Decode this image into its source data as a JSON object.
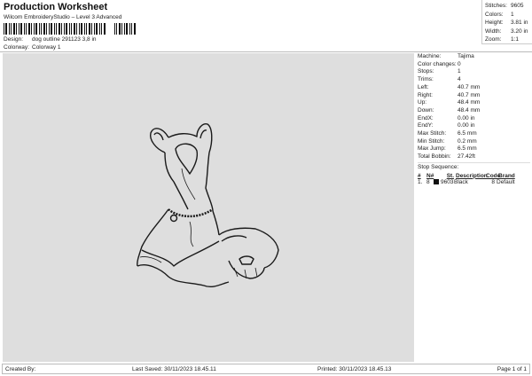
{
  "header": {
    "title": "Production Worksheet",
    "subtitle": "Wilcom EmbroideryStudio – Level 3 Advanced",
    "design_label": "Design:",
    "design_value": "dog outline 291123 3,8 in",
    "colorway_label": "Colorway:",
    "colorway_value": "Colorway 1"
  },
  "summary": [
    {
      "label": "Stitches:",
      "value": "9605"
    },
    {
      "label": "Colors:",
      "value": "1"
    },
    {
      "label": "Height:",
      "value": "3.81 in"
    },
    {
      "label": "Width:",
      "value": "3.20 in"
    },
    {
      "label": "Zoom:",
      "value": "1:1"
    }
  ],
  "details": [
    {
      "label": "Machine:",
      "value": "Tajima"
    },
    {
      "label": "Color changes:",
      "value": "0"
    },
    {
      "label": "Stops:",
      "value": "1"
    },
    {
      "label": "Trims:",
      "value": "4"
    },
    {
      "label": "Left:",
      "value": "40.7 mm"
    },
    {
      "label": "Right:",
      "value": "40.7 mm"
    },
    {
      "label": "Up:",
      "value": "48.4 mm"
    },
    {
      "label": "Down:",
      "value": "48.4 mm"
    },
    {
      "label": "EndX:",
      "value": "0.00 in"
    },
    {
      "label": "EndY:",
      "value": "0.00 in"
    },
    {
      "label": "Max Stitch:",
      "value": "6.5 mm"
    },
    {
      "label": "Min Stitch:",
      "value": "0.2 mm"
    },
    {
      "label": "Max Jump:",
      "value": "6.5 mm"
    },
    {
      "label": "Total Bobbin:",
      "value": "27.42ft"
    }
  ],
  "stop_sequence": {
    "title": "Stop Sequence:",
    "headers": [
      "#",
      "N#",
      "St.",
      "Description",
      "Code",
      "Brand"
    ],
    "rows": [
      {
        "num": "1.",
        "n": "8",
        "color": "#111111",
        "st": "9603",
        "desc": "Black",
        "code": "8",
        "brand": "Default"
      }
    ]
  },
  "footer": {
    "created": "Created By:",
    "saved": "Last Saved: 30/11/2023 18.45.11",
    "printed": "Printed: 30/11/2023 18.45.13",
    "page": "Page 1 of 1"
  }
}
